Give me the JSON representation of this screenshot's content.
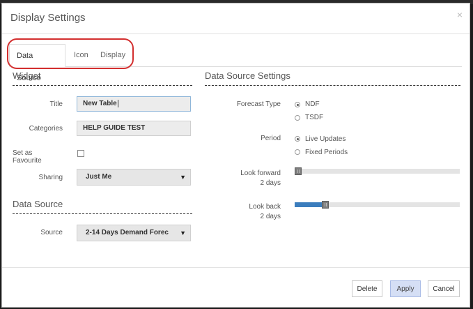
{
  "dialog": {
    "title": "Display Settings",
    "close_label": "×"
  },
  "tabs": [
    {
      "label": "Data Source",
      "active": true
    },
    {
      "label": "Icon",
      "active": false
    },
    {
      "label": "Display",
      "active": false
    }
  ],
  "widget": {
    "section_title": "Widget",
    "title_label": "Title",
    "title_value": "New Table",
    "categories_label": "Categories",
    "categories_value": "HELP GUIDE TEST",
    "favourite_label": "Set as Favourite",
    "favourite_checked": false,
    "sharing_label": "Sharing",
    "sharing_value": "Just Me",
    "select_arrow": "▼"
  },
  "data_source": {
    "section_title": "Data Source",
    "source_label": "Source",
    "source_value": "2-14 Days Demand Forec"
  },
  "data_source_settings": {
    "section_title": "Data Source Settings",
    "forecast_type_label": "Forecast Type",
    "forecast_options": [
      "NDF",
      "TSDF"
    ],
    "forecast_selected": "NDF",
    "period_label": "Period",
    "period_options": [
      "Live Updates",
      "Fixed Periods"
    ],
    "period_selected": "Live Updates",
    "look_forward_label": "Look forward",
    "look_forward_value": "2 days",
    "look_forward_fraction": 0.0,
    "look_back_label": "Look back",
    "look_back_value": "2 days",
    "look_back_fraction": 0.17
  },
  "footer": {
    "delete_label": "Delete",
    "apply_label": "Apply",
    "cancel_label": "Cancel"
  },
  "colors": {
    "accent": "#3b7dbd",
    "highlight": "#d32f2f",
    "primary_button": "#d5dff5"
  }
}
